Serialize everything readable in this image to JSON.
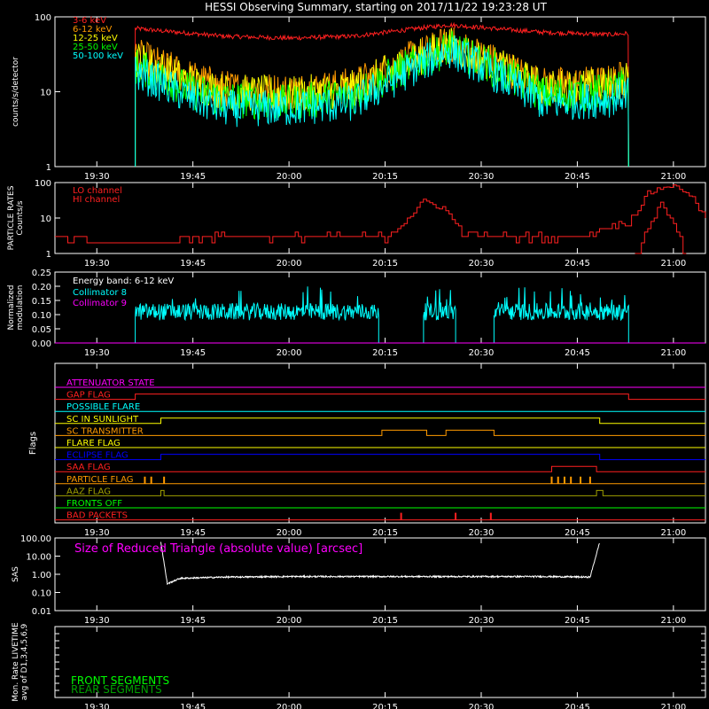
{
  "title": "HESSI Observing Summary, starting on 2017/11/22 19:23:28 UT",
  "time_axis": {
    "start": "19:23:28",
    "end": "21:05",
    "major_ticks": [
      "19:30",
      "19:45",
      "20:00",
      "20:15",
      "20:30",
      "20:45",
      "21:00"
    ]
  },
  "colors": {
    "background": "#000000",
    "axes": "#ffffff",
    "red": "#ff2020",
    "orange": "#ff9a00",
    "yellow": "#ffff00",
    "green": "#00ff00",
    "cyan": "#00ffff",
    "magenta": "#ff00ff",
    "blue": "#0000ff",
    "olive": "#a0a000",
    "dark_green": "#00a000"
  },
  "chart_data": [
    {
      "id": "counts",
      "type": "line",
      "ylabel": "counts/s/detector",
      "y_scale": "log",
      "ylim": [
        1,
        100
      ],
      "y_ticks": [
        "1",
        "10",
        "100"
      ],
      "series": [
        {
          "name": "3-6 keV",
          "color": "#ff2020",
          "x": [
            "19:36:00",
            "19:40",
            "19:50",
            "20:00",
            "20:10",
            "20:20",
            "20:25",
            "20:30",
            "20:40",
            "20:50",
            "20:53:00"
          ],
          "values": [
            70,
            65,
            55,
            52,
            55,
            70,
            78,
            72,
            62,
            58,
            60
          ]
        },
        {
          "name": "6-12 keV",
          "color": "#ff9a00",
          "x": [
            "19:36:00",
            "19:40",
            "19:45",
            "19:50",
            "20:00",
            "20:10",
            "20:20",
            "20:25",
            "20:30",
            "20:40",
            "20:50",
            "20:53:00"
          ],
          "values": [
            30,
            22,
            15,
            11,
            10,
            12,
            30,
            44,
            30,
            12,
            13,
            16
          ]
        },
        {
          "name": "12-25 keV",
          "color": "#ffff00",
          "x": [
            "19:36:00",
            "19:40",
            "19:45",
            "19:50",
            "20:00",
            "20:10",
            "20:20",
            "20:25",
            "20:30",
            "20:40",
            "20:50",
            "20:53:00"
          ],
          "values": [
            28,
            20,
            13,
            10,
            9,
            11,
            28,
            42,
            28,
            11,
            12,
            15
          ]
        },
        {
          "name": "25-50 keV",
          "color": "#00ff00",
          "x": [
            "19:36:00",
            "19:40",
            "19:45",
            "19:50",
            "20:00",
            "20:10",
            "20:20",
            "20:25",
            "20:30",
            "20:40",
            "20:50",
            "20:53:00"
          ],
          "values": [
            22,
            16,
            10,
            8,
            7,
            9,
            25,
            38,
            25,
            9,
            10,
            12
          ]
        },
        {
          "name": "50-100 keV",
          "color": "#00ffff",
          "x": [
            "19:36:00",
            "19:40",
            "19:45",
            "19:50",
            "20:00",
            "20:10",
            "20:20",
            "20:25",
            "20:30",
            "20:40",
            "20:50",
            "20:53:00"
          ],
          "values": [
            18,
            13,
            8,
            6,
            6,
            7,
            22,
            36,
            22,
            7,
            8,
            10
          ]
        }
      ]
    },
    {
      "id": "particle",
      "type": "line",
      "ylabel": "PARTICLE RATES Counts/s",
      "y_scale": "log",
      "ylim": [
        1,
        100
      ],
      "y_ticks": [
        "1",
        "10",
        "100"
      ],
      "series": [
        {
          "name": "LO channel",
          "color": "#ff2020",
          "x": [
            "19:23:28",
            "19:30",
            "19:40",
            "19:45",
            "20:00",
            "20:15",
            "20:18",
            "20:21",
            "20:24",
            "20:27",
            "20:30",
            "20:45",
            "20:53",
            "20:56",
            "20:59",
            "21:02",
            "21:05"
          ],
          "values": [
            3,
            2,
            2,
            3,
            3,
            3,
            8,
            30,
            20,
            4,
            3,
            3,
            8,
            50,
            85,
            60,
            10
          ]
        },
        {
          "name": "HI channel",
          "color": "#ff2020",
          "x": [
            "20:54",
            "20:56",
            "20:58",
            "21:00",
            "21:02"
          ],
          "values": [
            1,
            5,
            25,
            8,
            1
          ]
        }
      ]
    },
    {
      "id": "modulation",
      "type": "line",
      "ylabel": "Normalized modulation",
      "ylim": [
        0.0,
        0.25
      ],
      "y_ticks": [
        "0.00",
        "0.05",
        "0.10",
        "0.15",
        "0.20",
        "0.25"
      ],
      "annotation": "Energy band: 6-12 keV",
      "series": [
        {
          "name": "Collimator 8",
          "color": "#00ffff",
          "segments": [
            [
              "19:36:00",
              "20:14:00"
            ],
            [
              "20:21:00",
              "20:26:00"
            ],
            [
              "20:32:00",
              "20:53:00"
            ]
          ],
          "mean": 0.11
        },
        {
          "name": "Collimator 9",
          "color": "#ff00ff",
          "segments": [
            [
              "19:23:28",
              "21:05:00"
            ]
          ],
          "mean": 0.0
        }
      ]
    },
    {
      "id": "flags",
      "type": "line",
      "ylabel": "Flags",
      "flags": [
        {
          "name": "ATTENUATOR STATE",
          "color": "#ff00ff",
          "transitions": []
        },
        {
          "name": "GAP FLAG",
          "color": "#ff2020",
          "transitions": [
            "19:36:00",
            "20:53:00"
          ]
        },
        {
          "name": "POSSIBLE FLARE",
          "color": "#00ffff",
          "transitions": []
        },
        {
          "name": "SC IN SUNLIGHT",
          "color": "#ffff00",
          "transitions": [
            "19:40:00",
            "20:48:30"
          ]
        },
        {
          "name": "SC TRANSMITTER",
          "color": "#ff9a00",
          "transitions": [
            "20:14:30",
            "20:21:30",
            "20:24:30",
            "20:32:00"
          ]
        },
        {
          "name": "FLARE FLAG",
          "color": "#ffff00",
          "transitions": []
        },
        {
          "name": "ECLIPSE FLAG",
          "color": "#0000ff",
          "transitions": [
            "19:40:00",
            "20:48:30"
          ]
        },
        {
          "name": "SAA FLAG",
          "color": "#ff2020",
          "transitions": [
            "20:41:00",
            "20:48:00"
          ]
        },
        {
          "name": "PARTICLE FLAG",
          "color": "#ff9a00",
          "pulses": [
            "19:37:30",
            "19:38:30",
            "19:40:30",
            "20:41:00",
            "20:42:00",
            "20:43:00",
            "20:44:00",
            "20:45:30",
            "20:47:00"
          ]
        },
        {
          "name": "AAZ FLAG",
          "color": "#a0a000",
          "transitions": [
            "19:40:00",
            "19:40:30",
            "20:48:00",
            "20:49:00"
          ]
        },
        {
          "name": "FRONTS OFF",
          "color": "#00ff00",
          "transitions": []
        },
        {
          "name": "BAD PACKETS",
          "color": "#ff2020",
          "pulses": [
            "20:17:30",
            "20:26:00",
            "20:31:30"
          ]
        }
      ]
    },
    {
      "id": "sas",
      "type": "line",
      "ylabel": "SAS",
      "y_scale": "log",
      "ylim": [
        0.01,
        100
      ],
      "y_ticks": [
        "0.01",
        "0.10",
        "1.00",
        "10.00",
        "100.00"
      ],
      "annotation": "Size of Reduced Triangle (absolute value) [arcsec]",
      "series": [
        {
          "name": "",
          "color": "#ffffff",
          "x": [
            "19:40:00",
            "19:41:00",
            "19:43:00",
            "19:50:00",
            "20:00:00",
            "20:20:00",
            "20:40:00",
            "20:47:00",
            "20:48:30"
          ],
          "values": [
            60,
            0.3,
            0.6,
            0.7,
            0.75,
            0.75,
            0.75,
            0.7,
            60
          ]
        }
      ]
    },
    {
      "id": "livetime",
      "type": "line",
      "ylabel": "Mon. Rate LIVETIME avg of D1,3,4,5,6,9",
      "ylim": [
        0,
        1
      ],
      "legend": [
        {
          "name": "FRONT SEGMENTS",
          "color": "#00ff00"
        },
        {
          "name": "REAR SEGMENTS",
          "color": "#00a000"
        }
      ],
      "series": []
    }
  ]
}
